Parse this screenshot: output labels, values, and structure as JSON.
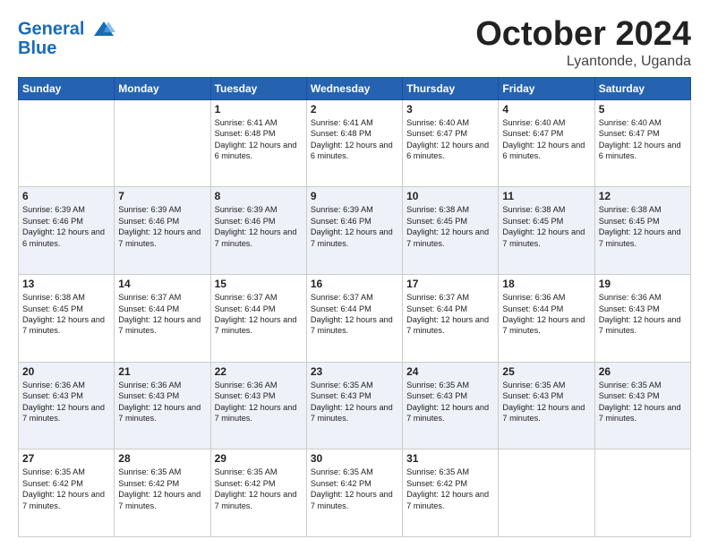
{
  "header": {
    "logo_line1": "General",
    "logo_line2": "Blue",
    "month": "October 2024",
    "location": "Lyantonde, Uganda"
  },
  "weekdays": [
    "Sunday",
    "Monday",
    "Tuesday",
    "Wednesday",
    "Thursday",
    "Friday",
    "Saturday"
  ],
  "weeks": [
    [
      {
        "day": "",
        "empty": true
      },
      {
        "day": "",
        "empty": true
      },
      {
        "day": "1",
        "sunrise": "6:41 AM",
        "sunset": "6:48 PM",
        "daylight": "12 hours and 6 minutes."
      },
      {
        "day": "2",
        "sunrise": "6:41 AM",
        "sunset": "6:48 PM",
        "daylight": "12 hours and 6 minutes."
      },
      {
        "day": "3",
        "sunrise": "6:40 AM",
        "sunset": "6:47 PM",
        "daylight": "12 hours and 6 minutes."
      },
      {
        "day": "4",
        "sunrise": "6:40 AM",
        "sunset": "6:47 PM",
        "daylight": "12 hours and 6 minutes."
      },
      {
        "day": "5",
        "sunrise": "6:40 AM",
        "sunset": "6:47 PM",
        "daylight": "12 hours and 6 minutes."
      }
    ],
    [
      {
        "day": "6",
        "sunrise": "6:39 AM",
        "sunset": "6:46 PM",
        "daylight": "12 hours and 6 minutes."
      },
      {
        "day": "7",
        "sunrise": "6:39 AM",
        "sunset": "6:46 PM",
        "daylight": "12 hours and 7 minutes."
      },
      {
        "day": "8",
        "sunrise": "6:39 AM",
        "sunset": "6:46 PM",
        "daylight": "12 hours and 7 minutes."
      },
      {
        "day": "9",
        "sunrise": "6:39 AM",
        "sunset": "6:46 PM",
        "daylight": "12 hours and 7 minutes."
      },
      {
        "day": "10",
        "sunrise": "6:38 AM",
        "sunset": "6:45 PM",
        "daylight": "12 hours and 7 minutes."
      },
      {
        "day": "11",
        "sunrise": "6:38 AM",
        "sunset": "6:45 PM",
        "daylight": "12 hours and 7 minutes."
      },
      {
        "day": "12",
        "sunrise": "6:38 AM",
        "sunset": "6:45 PM",
        "daylight": "12 hours and 7 minutes."
      }
    ],
    [
      {
        "day": "13",
        "sunrise": "6:38 AM",
        "sunset": "6:45 PM",
        "daylight": "12 hours and 7 minutes."
      },
      {
        "day": "14",
        "sunrise": "6:37 AM",
        "sunset": "6:44 PM",
        "daylight": "12 hours and 7 minutes."
      },
      {
        "day": "15",
        "sunrise": "6:37 AM",
        "sunset": "6:44 PM",
        "daylight": "12 hours and 7 minutes."
      },
      {
        "day": "16",
        "sunrise": "6:37 AM",
        "sunset": "6:44 PM",
        "daylight": "12 hours and 7 minutes."
      },
      {
        "day": "17",
        "sunrise": "6:37 AM",
        "sunset": "6:44 PM",
        "daylight": "12 hours and 7 minutes."
      },
      {
        "day": "18",
        "sunrise": "6:36 AM",
        "sunset": "6:44 PM",
        "daylight": "12 hours and 7 minutes."
      },
      {
        "day": "19",
        "sunrise": "6:36 AM",
        "sunset": "6:43 PM",
        "daylight": "12 hours and 7 minutes."
      }
    ],
    [
      {
        "day": "20",
        "sunrise": "6:36 AM",
        "sunset": "6:43 PM",
        "daylight": "12 hours and 7 minutes."
      },
      {
        "day": "21",
        "sunrise": "6:36 AM",
        "sunset": "6:43 PM",
        "daylight": "12 hours and 7 minutes."
      },
      {
        "day": "22",
        "sunrise": "6:36 AM",
        "sunset": "6:43 PM",
        "daylight": "12 hours and 7 minutes."
      },
      {
        "day": "23",
        "sunrise": "6:35 AM",
        "sunset": "6:43 PM",
        "daylight": "12 hours and 7 minutes."
      },
      {
        "day": "24",
        "sunrise": "6:35 AM",
        "sunset": "6:43 PM",
        "daylight": "12 hours and 7 minutes."
      },
      {
        "day": "25",
        "sunrise": "6:35 AM",
        "sunset": "6:43 PM",
        "daylight": "12 hours and 7 minutes."
      },
      {
        "day": "26",
        "sunrise": "6:35 AM",
        "sunset": "6:43 PM",
        "daylight": "12 hours and 7 minutes."
      }
    ],
    [
      {
        "day": "27",
        "sunrise": "6:35 AM",
        "sunset": "6:42 PM",
        "daylight": "12 hours and 7 minutes."
      },
      {
        "day": "28",
        "sunrise": "6:35 AM",
        "sunset": "6:42 PM",
        "daylight": "12 hours and 7 minutes."
      },
      {
        "day": "29",
        "sunrise": "6:35 AM",
        "sunset": "6:42 PM",
        "daylight": "12 hours and 7 minutes."
      },
      {
        "day": "30",
        "sunrise": "6:35 AM",
        "sunset": "6:42 PM",
        "daylight": "12 hours and 7 minutes."
      },
      {
        "day": "31",
        "sunrise": "6:35 AM",
        "sunset": "6:42 PM",
        "daylight": "12 hours and 7 minutes."
      },
      {
        "day": "",
        "empty": true
      },
      {
        "day": "",
        "empty": true
      }
    ]
  ]
}
